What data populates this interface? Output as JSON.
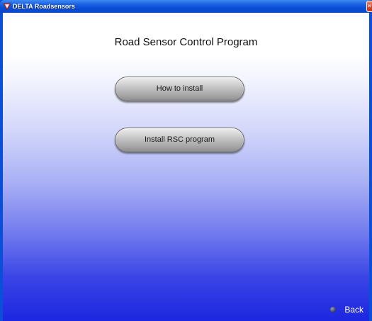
{
  "window": {
    "title": "DELTA Roadsensors",
    "close_glyph": "×"
  },
  "main": {
    "heading": "Road Sensor Control Program",
    "buttons": [
      {
        "label": "How to install"
      },
      {
        "label": "Install RSC program"
      }
    ],
    "back_label": "Back"
  },
  "colors": {
    "titlebar": "#0a4fd8",
    "close_button": "#d5452a",
    "gradient_top": "#ffffff",
    "gradient_bottom": "#1c26e0",
    "button_gray": "#b4b4b4"
  },
  "icons": {
    "app_icon": "delta-logo-icon",
    "back_icon": "dot-icon",
    "close_icon": "close-icon"
  }
}
